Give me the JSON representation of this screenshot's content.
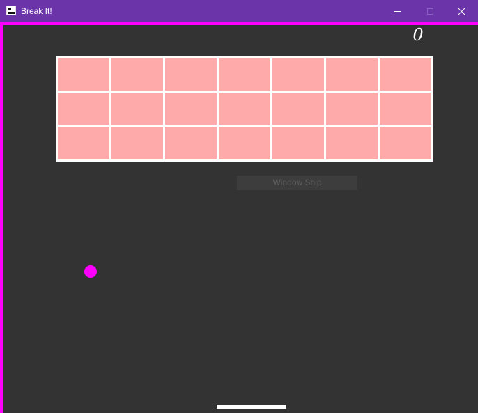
{
  "window": {
    "title": "Break It!"
  },
  "controls": {
    "minimize_icon": "minimize-icon",
    "maximize_icon": "maximize-icon",
    "close_icon": "close-icon"
  },
  "game": {
    "score": "0",
    "brick_rows": 3,
    "brick_cols": 7,
    "overlay_text": "Window Snip"
  },
  "colors": {
    "titlebar": "#6b34a8",
    "background": "#333333",
    "border": "#ff00ff",
    "brick": "#ffaaaa",
    "brick_grid_lines": "#ffffff",
    "ball": "#ff00ff",
    "paddle": "#ffffff",
    "score": "#ffffff"
  }
}
